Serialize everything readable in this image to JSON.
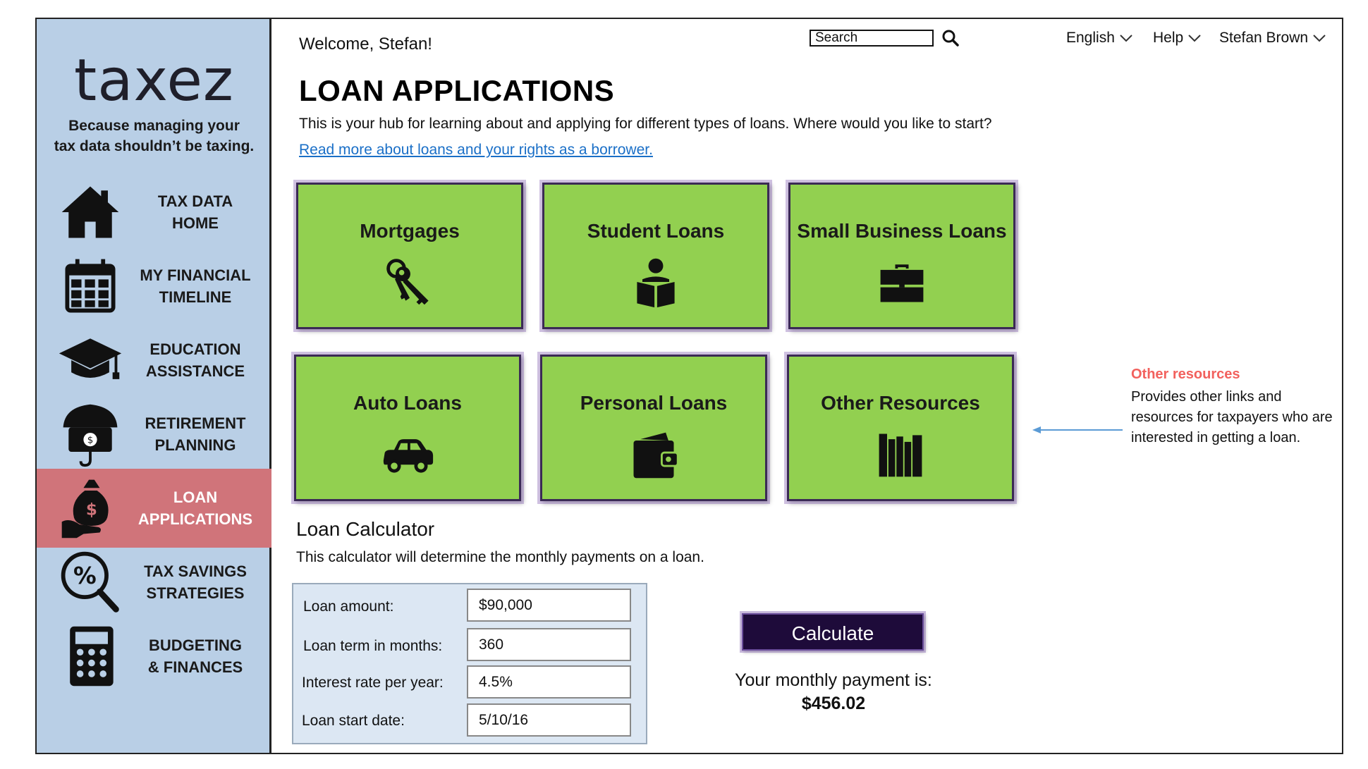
{
  "sidebar": {
    "logo": "taxez",
    "tagline": "Because managing your\ntax data shouldn’t be taxing.",
    "items": [
      {
        "label": "TAX DATA\nHOME",
        "icon": "house-icon"
      },
      {
        "label": "MY FINANCIAL\nTIMELINE",
        "icon": "calendar-icon"
      },
      {
        "label": "EDUCATION\nASSISTANCE",
        "icon": "graduation-cap-icon"
      },
      {
        "label": "RETIREMENT\nPLANNING",
        "icon": "umbrella-money-icon"
      },
      {
        "label": "LOAN\nAPPLICATIONS",
        "icon": "money-bag-hand-icon",
        "active": true
      },
      {
        "label": "TAX SAVINGS\nSTRATEGIES",
        "icon": "percent-magnifier-icon"
      },
      {
        "label": "BUDGETING\n& FINANCES",
        "icon": "calculator-icon"
      }
    ]
  },
  "header": {
    "welcome": "Welcome, Stefan!",
    "search_value": "Search",
    "language": "English",
    "help": "Help",
    "user": "Stefan Brown"
  },
  "main": {
    "title": "LOAN APPLICATIONS",
    "intro": "This is your hub for learning about and applying for different types of loans. Where would you like to start?",
    "read_more": "Read more about loans and your rights as a borrower.",
    "tiles": [
      {
        "label": "Mortgages",
        "icon": "keys-icon"
      },
      {
        "label": "Student Loans",
        "icon": "student-reading-icon"
      },
      {
        "label": "Small Business Loans",
        "icon": "briefcase-icon"
      },
      {
        "label": "Auto Loans",
        "icon": "car-icon"
      },
      {
        "label": "Personal Loans",
        "icon": "wallet-icon"
      },
      {
        "label": "Other Resources",
        "icon": "books-icon"
      }
    ]
  },
  "annotation": {
    "title": "Other resources",
    "text": "Provides other links and resources for taxpayers who are interested in getting a loan."
  },
  "calculator": {
    "title": "Loan Calculator",
    "description": "This calculator will determine the monthly payments on a loan.",
    "fields": [
      {
        "label": "Loan amount:",
        "value": "$90,000"
      },
      {
        "label": "Loan term in months:",
        "value": "360"
      },
      {
        "label": "Interest rate per year:",
        "value": "4.5%"
      },
      {
        "label": "Loan start date:",
        "value": "5/10/16"
      }
    ],
    "button": "Calculate",
    "result_label": "Your monthly payment is:",
    "result_value": "$456.02"
  },
  "colors": {
    "sidebar_bg": "#b9cfe6",
    "active_nav": "#d0747a",
    "tile_green": "#92d050",
    "button_dark": "#1e0b3a",
    "link_blue": "#1a6fc7",
    "annotation_red": "#f2615d"
  }
}
